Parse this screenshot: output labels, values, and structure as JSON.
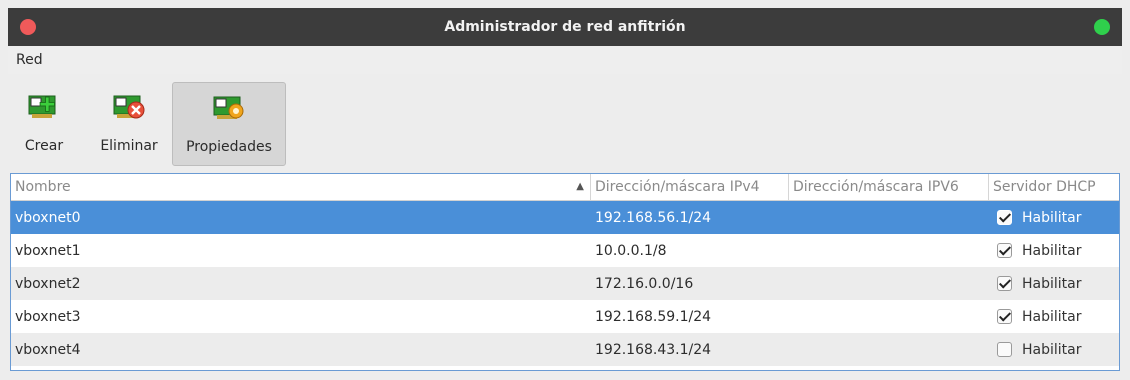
{
  "window": {
    "title": "Administrador de red anfitrión"
  },
  "menu": {
    "items": [
      "Red"
    ]
  },
  "toolbar": {
    "create_label": "Crear",
    "delete_label": "Eliminar",
    "properties_label": "Propiedades",
    "active": "properties",
    "icons": {
      "create": "network-card-add-icon",
      "delete": "network-card-remove-icon",
      "properties": "network-card-settings-icon"
    }
  },
  "table": {
    "columns": [
      "Nombre",
      "Dirección/máscara IPv4",
      "Dirección/máscara IPV6",
      "Servidor DHCP"
    ],
    "sort_column": "Nombre",
    "sort_order": "ascending",
    "rows": [
      {
        "name": "vboxnet0",
        "ipv4": "192.168.56.1/24",
        "ipv6": "",
        "dhcp_checked": true,
        "dhcp_label": "Habilitar",
        "selected": true
      },
      {
        "name": "vboxnet1",
        "ipv4": "10.0.0.1/8",
        "ipv6": "",
        "dhcp_checked": true,
        "dhcp_label": "Habilitar",
        "selected": false
      },
      {
        "name": "vboxnet2",
        "ipv4": "172.16.0.0/16",
        "ipv6": "",
        "dhcp_checked": true,
        "dhcp_label": "Habilitar",
        "selected": false
      },
      {
        "name": "vboxnet3",
        "ipv4": "192.168.59.1/24",
        "ipv6": "",
        "dhcp_checked": true,
        "dhcp_label": "Habilitar",
        "selected": false
      },
      {
        "name": "vboxnet4",
        "ipv4": "192.168.43.1/24",
        "ipv6": "",
        "dhcp_checked": false,
        "dhcp_label": "Habilitar",
        "selected": false
      }
    ]
  },
  "colors": {
    "selection": "#4a8fd8",
    "titlebar": "#3c3c3c",
    "close": "#f05a5a",
    "maximize": "#2fd04c"
  }
}
